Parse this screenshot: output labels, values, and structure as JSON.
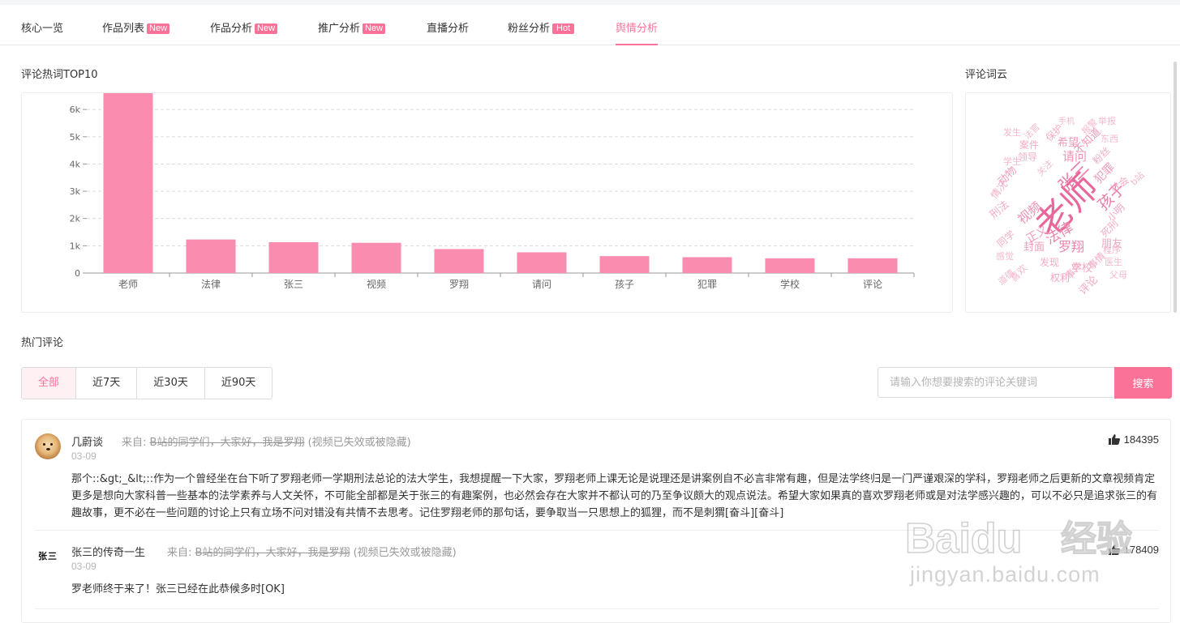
{
  "tabs": [
    {
      "label": "核心一览",
      "badge": ""
    },
    {
      "label": "作品列表",
      "badge": "New"
    },
    {
      "label": "作品分析",
      "badge": "New"
    },
    {
      "label": "推广分析",
      "badge": "New"
    },
    {
      "label": "直播分析",
      "badge": ""
    },
    {
      "label": "粉丝分析",
      "badge": "Hot"
    },
    {
      "label": "舆情分析",
      "badge": ""
    }
  ],
  "active_tab": "舆情分析",
  "hot_words": {
    "title": "评论热词TOP10",
    "chart_data": {
      "type": "bar",
      "categories": [
        "老师",
        "法律",
        "张三",
        "视频",
        "罗翔",
        "请问",
        "孩子",
        "犯罪",
        "学校",
        "评论"
      ],
      "values": [
        6600,
        1230,
        1130,
        1110,
        880,
        760,
        620,
        580,
        540,
        540
      ],
      "yticks": [
        "0",
        "1k",
        "2k",
        "3k",
        "4k",
        "5k",
        "6k"
      ],
      "ylim": [
        0,
        6600
      ],
      "grid": true,
      "bar_color": "#f98caf"
    }
  },
  "word_cloud": {
    "title": "评论词云",
    "words": [
      "老师",
      "张三",
      "孩子",
      "法律",
      "视频",
      "罗翔",
      "正义",
      "请问",
      "犯罪",
      "学校",
      "评论",
      "朋友",
      "小明",
      "社会",
      "粉丝",
      "b站",
      "希望",
      "不知道",
      "保护",
      "案件",
      "领导",
      "学生",
      "动物",
      "情况",
      "刑法",
      "同学",
      "封面",
      "发现",
      "感觉",
      "喜欢",
      "道德",
      "权利",
      "事件",
      "事情",
      "医生",
      "父母",
      "程序",
      "死刑",
      "举报",
      "东西",
      "手机",
      "报警",
      "发生",
      "法官",
      "关注"
    ]
  },
  "hot_comments": {
    "title": "热门评论",
    "filters": [
      "全部",
      "近7天",
      "近30天",
      "近90天"
    ],
    "active_filter": "全部",
    "search_placeholder": "请输入你想要搜索的评论关键词",
    "search_button": "搜索",
    "items": [
      {
        "user": "几蔚谈",
        "from_label": "来自:",
        "source": "B站的同学们，大家好，我是罗翔",
        "source_note": "(视频已失效或被隐藏)",
        "date": "03-09",
        "likes": "184395",
        "text": "那个::&gt;_&lt;::作为一个曾经坐在台下听了罗翔老师一学期刑法总论的法大学生，我想提醒一下大家，罗翔老师上课无论是说理还是讲案例自不必言非常有趣，但是法学终归是一门严谨艰深的学科，罗翔老师之后更新的文章视频肯定更多是想向大家科普一些基本的法学素养与人文关怀，不可能全部都是关于张三的有趣案例，也必然会存在大家并不都认可的乃至争议颇大的观点说法。希望大家如果真的喜欢罗翔老师或是对法学感兴趣的，可以不必只是追求张三的有趣故事，更不必在一些问题的讨论上只有立场不问对错没有共情不去思考。记住罗翔老师的那句话，要争取当一只思想上的狐狸，而不是刺猬[奋斗][奋斗]"
      },
      {
        "user": "张三的传奇一生",
        "from_label": "来自:",
        "source": "B站的同学们，大家好，我是罗翔",
        "source_note": "(视频已失效或被隐藏)",
        "date": "03-09",
        "likes": "178409",
        "avatar_text": "张三",
        "text": "罗老师终于来了！张三已经在此恭候多时[OK]"
      }
    ]
  },
  "watermark": {
    "logo": "Baidu",
    "cn": "经验",
    "url": "jingyan.baidu.com"
  }
}
